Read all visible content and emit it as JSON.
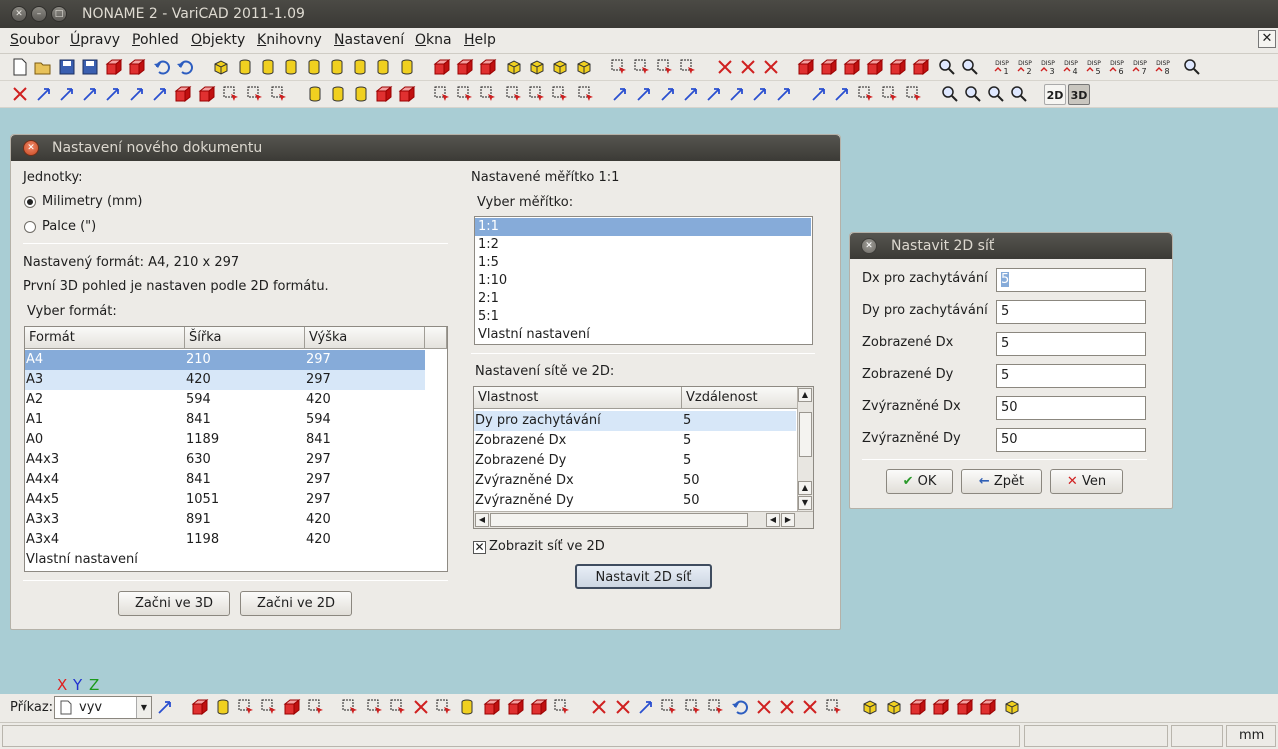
{
  "window": {
    "title": "NONAME 2 - VariCAD 2011-1.09"
  },
  "menu": [
    "Soubor",
    "Úpravy",
    "Pohled",
    "Objekty",
    "Knihovny",
    "Nastavení",
    "Okna",
    "Help"
  ],
  "toolbar": {
    "btn_2d": "2D",
    "btn_3d": "3D",
    "disp_labels": [
      "DISP 1",
      "DISP 2",
      "DISP 3",
      "DISP 4",
      "DISP 5",
      "DISP 6",
      "DISP 7",
      "DISP 8"
    ]
  },
  "dialog_new": {
    "title": "Nastavení nového dokumentu",
    "units_label": "Jednotky:",
    "unit_mm": "Milimetry (mm)",
    "unit_inch": "Palce (\")",
    "format_info": "Nastavený formát: A4, 210 x 297",
    "first_3d_info": "První 3D pohled je nastaven podle 2D formátu.",
    "choose_format": "Vyber formát:",
    "format_cols": [
      "Formát",
      "Šířka",
      "Výška"
    ],
    "formats": [
      [
        "A4",
        "210",
        "297"
      ],
      [
        "A3",
        "420",
        "297"
      ],
      [
        "A2",
        "594",
        "420"
      ],
      [
        "A1",
        "841",
        "594"
      ],
      [
        "A0",
        "1189",
        "841"
      ],
      [
        "A4x3",
        "630",
        "297"
      ],
      [
        "A4x4",
        "841",
        "297"
      ],
      [
        "A4x5",
        "1051",
        "297"
      ],
      [
        "A3x3",
        "891",
        "420"
      ],
      [
        "A3x4",
        "1198",
        "420"
      ],
      [
        "Vlastní nastavení",
        "",
        ""
      ]
    ],
    "btn_start_3d": "Začni ve 3D",
    "btn_start_2d": "Začni ve 2D",
    "scale_info": "Nastavené měřítko 1:1",
    "choose_scale": "Vyber měřítko:",
    "scales": [
      "1:1",
      "1:2",
      "1:5",
      "1:10",
      "2:1",
      "5:1",
      "Vlastní nastavení"
    ],
    "grid_label": "Nastavení sítě ve 2D:",
    "grid_cols": [
      "Vlastnost",
      "Vzdálenost"
    ],
    "grid_rows": [
      [
        "Dy pro zachytávání",
        "5"
      ],
      [
        "Zobrazené Dx",
        "5"
      ],
      [
        "Zobrazené Dy",
        "5"
      ],
      [
        "Zvýrazněné Dx",
        "50"
      ],
      [
        "Zvýrazněné Dy",
        "50"
      ]
    ],
    "show_grid": "Zobrazit síť ve 2D",
    "btn_set_grid": "Nastavit 2D síť"
  },
  "dialog_grid": {
    "title": "Nastavit 2D síť",
    "fields": [
      {
        "label": "Dx pro zachytávání",
        "value": "5"
      },
      {
        "label": "Dy pro zachytávání",
        "value": "5"
      },
      {
        "label": "Zobrazené Dx",
        "value": "5"
      },
      {
        "label": "Zobrazené Dy",
        "value": "5"
      },
      {
        "label": "Zvýrazněné Dx",
        "value": "50"
      },
      {
        "label": "Zvýrazněné Dy",
        "value": "50"
      }
    ],
    "ok": "OK",
    "back": "Zpět",
    "out": "Ven"
  },
  "axes": {
    "x": "X",
    "y": "Y",
    "z": "Z"
  },
  "command": {
    "label": "Příkaz:",
    "value": "vyv"
  },
  "status": {
    "units": "mm"
  },
  "colors": {
    "selection": "#86abd9",
    "selection_light": "#d7e7f8",
    "background": "#a9cdd4",
    "titlebar": "#3c3b37"
  }
}
